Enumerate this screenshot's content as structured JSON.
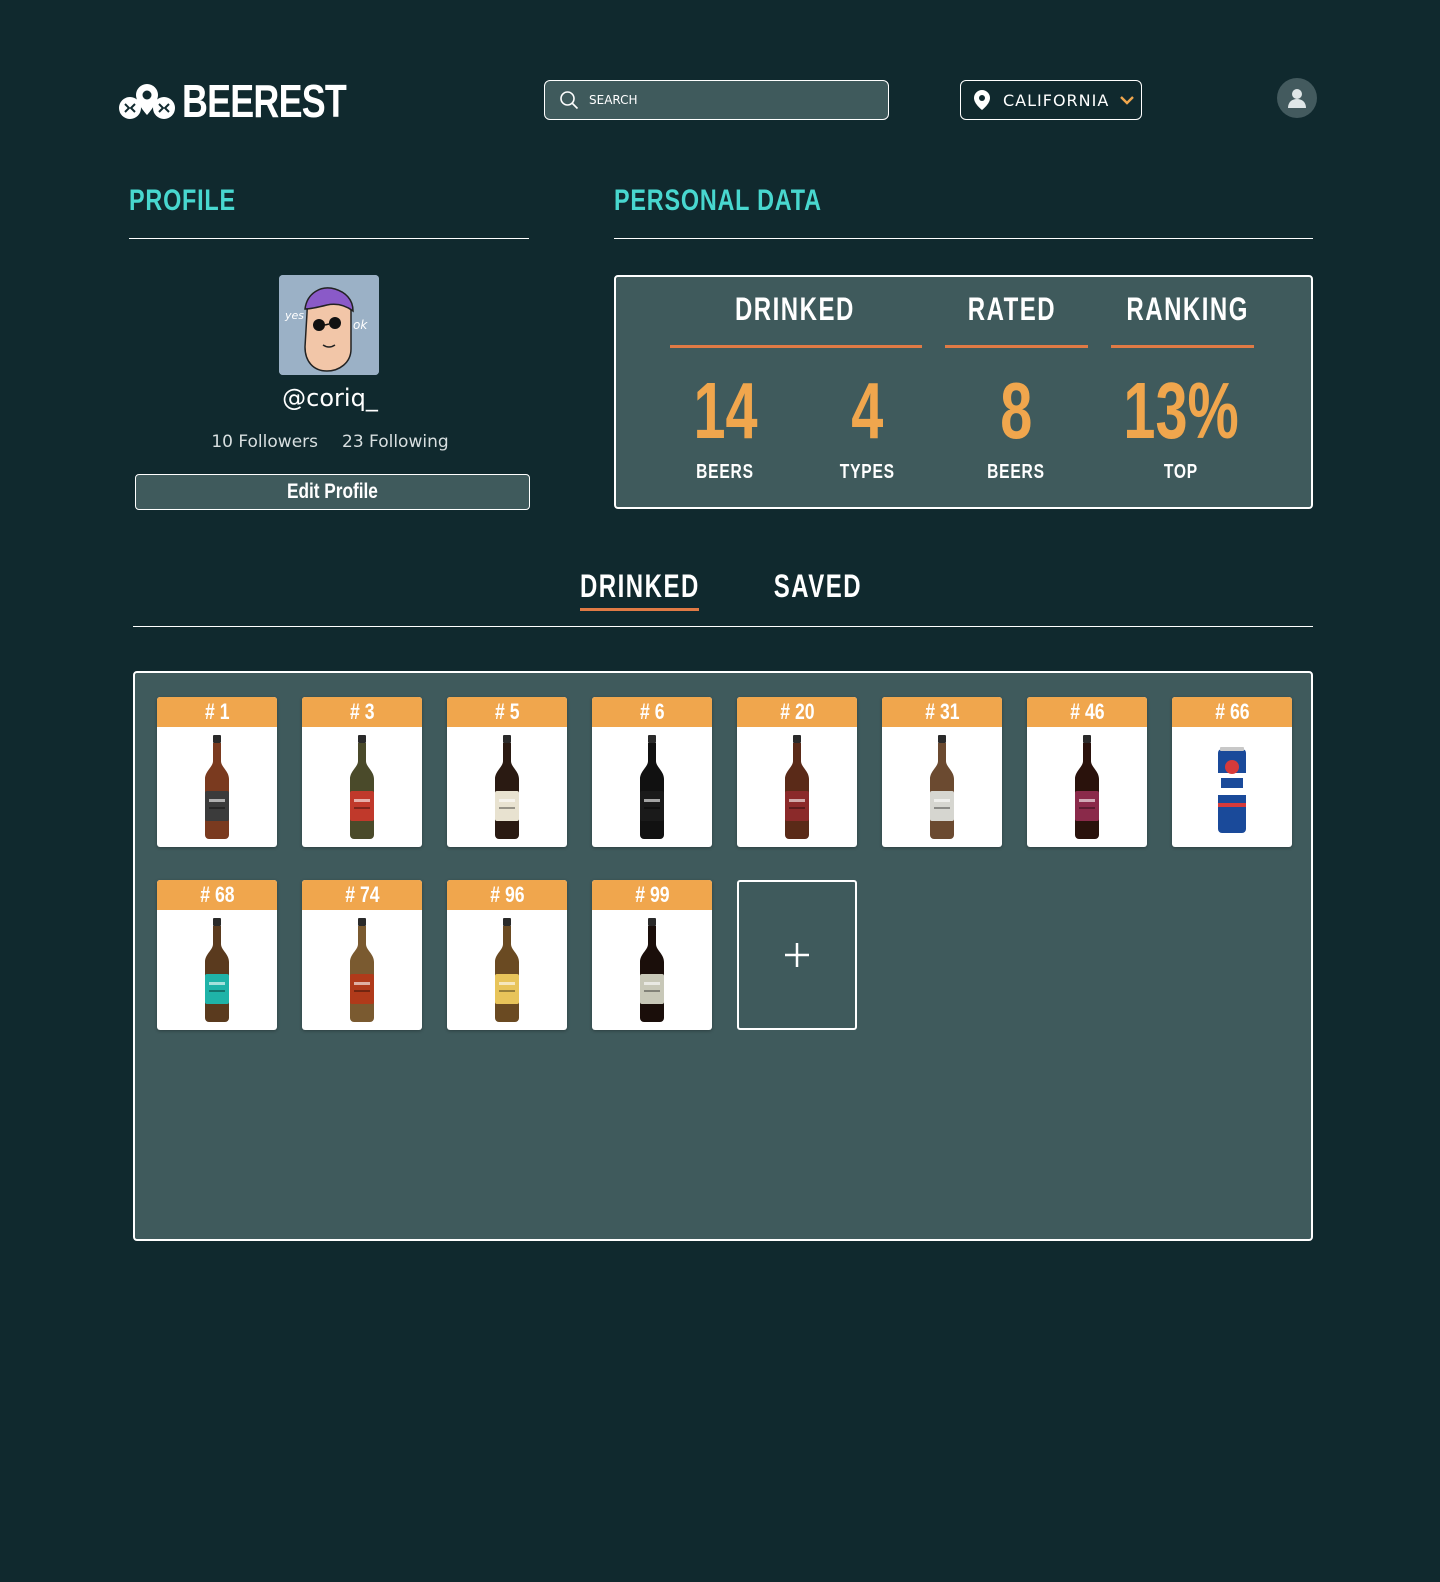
{
  "header": {
    "logo_text": "BEEREST",
    "search_placeholder": "SEARCH",
    "location": "CALIFORNIA",
    "icons": {
      "logo": "pin-cluster-logo-icon",
      "search": "search-icon",
      "location": "map-pin-icon",
      "dropdown": "chevron-down-icon",
      "user": "user-icon"
    }
  },
  "profile": {
    "title": "PROFILE",
    "username": "@coriq_",
    "followers": "10 Followers",
    "following": "23 Following",
    "edit_label": "Edit Profile"
  },
  "personal_data": {
    "title": "PERSONAL DATA",
    "headers": {
      "drinked": "DRINKED",
      "rated": "RATED",
      "ranking": "RANKING"
    },
    "stats": [
      {
        "value": "14",
        "label": "BEERS"
      },
      {
        "value": "4",
        "label": "TYPES"
      },
      {
        "value": "8",
        "label": "BEERS"
      },
      {
        "value": "13%",
        "label": "TOP"
      }
    ]
  },
  "tabs": {
    "drinked": "DRINKED",
    "saved": "SAVED",
    "active": "DRINKED"
  },
  "beers": [
    {
      "rank": "# 1",
      "color": "#7a3a1f",
      "label": "#3b3b3b"
    },
    {
      "rank": "# 3",
      "color": "#4a4a2a",
      "label": "#c0392b"
    },
    {
      "rank": "# 5",
      "color": "#2a1a12",
      "label": "#e8e2d0"
    },
    {
      "rank": "# 6",
      "color": "#111111",
      "label": "#1a1a1a"
    },
    {
      "rank": "# 20",
      "color": "#5a2a18",
      "label": "#8b2a2a"
    },
    {
      "rank": "# 31",
      "color": "#6b4a30",
      "label": "#d6d6d0"
    },
    {
      "rank": "# 46",
      "color": "#2a120c",
      "label": "#8a2a4a"
    },
    {
      "rank": "# 66",
      "color": "#1a4a9a",
      "label": "#d63a3a"
    },
    {
      "rank": "# 68",
      "color": "#5a3a1e",
      "label": "#1fb3a8"
    },
    {
      "rank": "# 74",
      "color": "#7a5a30",
      "label": "#b03a1a"
    },
    {
      "rank": "# 96",
      "color": "#6a4a22",
      "label": "#e8c45a"
    },
    {
      "rank": "# 99",
      "color": "#1a0e0a",
      "label": "#c8c8b8"
    }
  ],
  "add_card": {
    "icon": "plus-icon"
  }
}
